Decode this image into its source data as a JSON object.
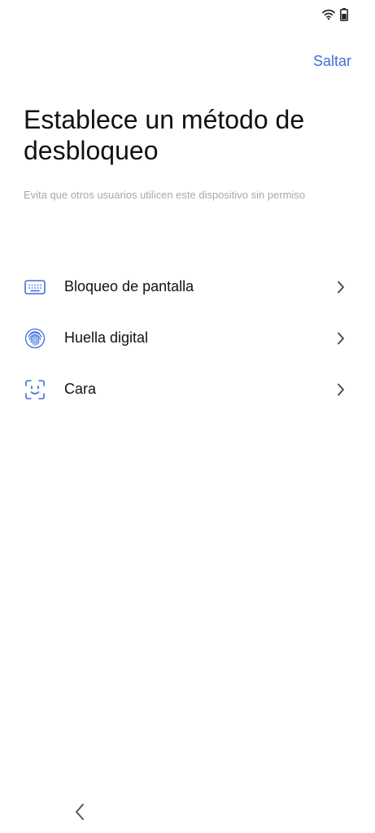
{
  "status_bar": {
    "icons": [
      "wifi-icon",
      "battery-icon"
    ]
  },
  "header": {
    "skip_label": "Saltar"
  },
  "main": {
    "title": "Establece un método de desbloqueo",
    "subtitle": "Evita que otros usuarios utilicen este dispositivo sin permiso",
    "methods": [
      {
        "label": "Bloqueo de pantalla",
        "icon": "keyboard-icon"
      },
      {
        "label": "Huella digital",
        "icon": "fingerprint-icon"
      },
      {
        "label": "Cara",
        "icon": "face-scan-icon"
      }
    ]
  },
  "navigation": {
    "back_icon": "chevron-left-icon"
  },
  "colors": {
    "accent": "#3f6fd8",
    "text_primary": "#111111",
    "text_secondary": "#a8a8a8",
    "background": "#ffffff"
  }
}
